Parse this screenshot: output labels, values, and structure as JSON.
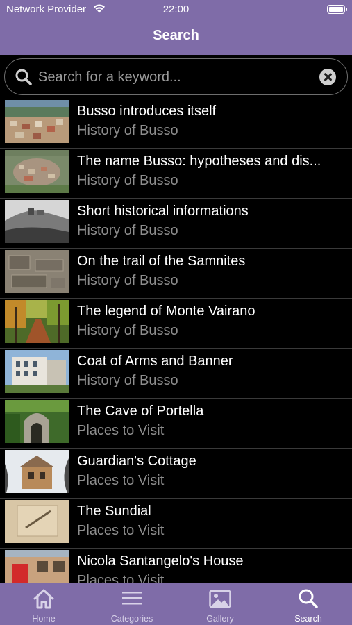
{
  "status": {
    "carrier": "Network Provider",
    "time": "22:00"
  },
  "header": {
    "title": "Search"
  },
  "search": {
    "placeholder": "Search for a keyword..."
  },
  "results": [
    {
      "title": "Busso introduces itself",
      "subtitle": "History of Busso",
      "thumb": "village-aerial"
    },
    {
      "title": "The name Busso: hypotheses and dis...",
      "subtitle": "History of Busso",
      "thumb": "town-aerial"
    },
    {
      "title": "Short historical informations",
      "subtitle": "History of Busso",
      "thumb": "bw-hilltop"
    },
    {
      "title": "On the trail of the Samnites",
      "subtitle": "History of Busso",
      "thumb": "excavation"
    },
    {
      "title": "The legend of Monte Vairano",
      "subtitle": "History of Busso",
      "thumb": "autumn-forest"
    },
    {
      "title": "Coat of Arms and Banner",
      "subtitle": "History of Busso",
      "thumb": "town-hall"
    },
    {
      "title": "The Cave of Portella",
      "subtitle": "Places to Visit",
      "thumb": "cave"
    },
    {
      "title": "Guardian's Cottage",
      "subtitle": "Places to Visit",
      "thumb": "cottage"
    },
    {
      "title": "The Sundial",
      "subtitle": "Places to Visit",
      "thumb": "sundial"
    },
    {
      "title": "Nicola Santangelo's House",
      "subtitle": "Places to Visit",
      "thumb": "house-red-door"
    }
  ],
  "tabs": [
    {
      "label": "Home",
      "icon": "home-icon"
    },
    {
      "label": "Categories",
      "icon": "list-icon"
    },
    {
      "label": "Gallery",
      "icon": "photo-icon"
    },
    {
      "label": "Search",
      "icon": "search-icon",
      "active": true
    }
  ],
  "colors": {
    "bar": "#7f6ca8",
    "background": "#000000",
    "subtitle": "#8e8e8e"
  }
}
